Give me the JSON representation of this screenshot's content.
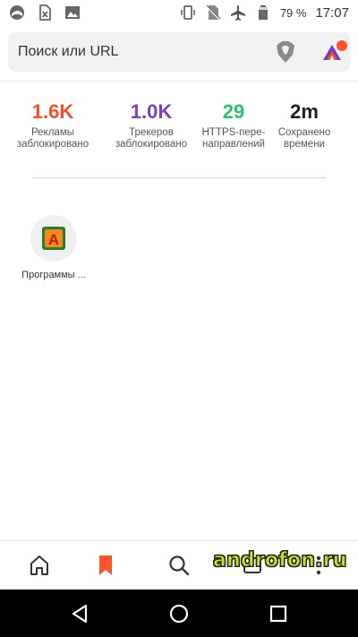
{
  "status_bar": {
    "battery_percent": "79 %",
    "time": "17:07",
    "left_icons": [
      "brave-notification-icon",
      "sim-card-icon",
      "image-icon"
    ],
    "right_icons": [
      "vibrate-icon",
      "no-sim-icon",
      "airplane-icon",
      "battery-icon"
    ]
  },
  "url_bar": {
    "placeholder": "Поиск или URL",
    "icons": [
      "brave-shield-icon",
      "brave-rewards-icon"
    ]
  },
  "stats": [
    {
      "value": "1.6K",
      "label_lines": [
        "Рекламы",
        "заблокировано"
      ],
      "color": "#e9532e"
    },
    {
      "value": "1.0K",
      "label_lines": [
        "Трекеров",
        "заблокировано"
      ],
      "color": "#7a3fbf"
    },
    {
      "value": "29",
      "label_lines": [
        "HTTPS-пере-",
        "направлений"
      ],
      "color": "#2fbf6a"
    },
    {
      "value": "2m",
      "label_lines": [
        "Сохранено",
        "времени"
      ],
      "color": "#1f1f1f"
    }
  ],
  "top_sites": [
    {
      "label": "Программы ...",
      "icon": "app-store-icon"
    }
  ],
  "bottom_nav": {
    "items": [
      "home-icon",
      "bookmark-icon",
      "search-icon",
      "tabs-icon",
      "menu-icon"
    ],
    "accent": "#fb542b"
  },
  "watermark": "androfon.ru",
  "system_nav": [
    "back-icon",
    "home-circle-icon",
    "recents-icon"
  ]
}
